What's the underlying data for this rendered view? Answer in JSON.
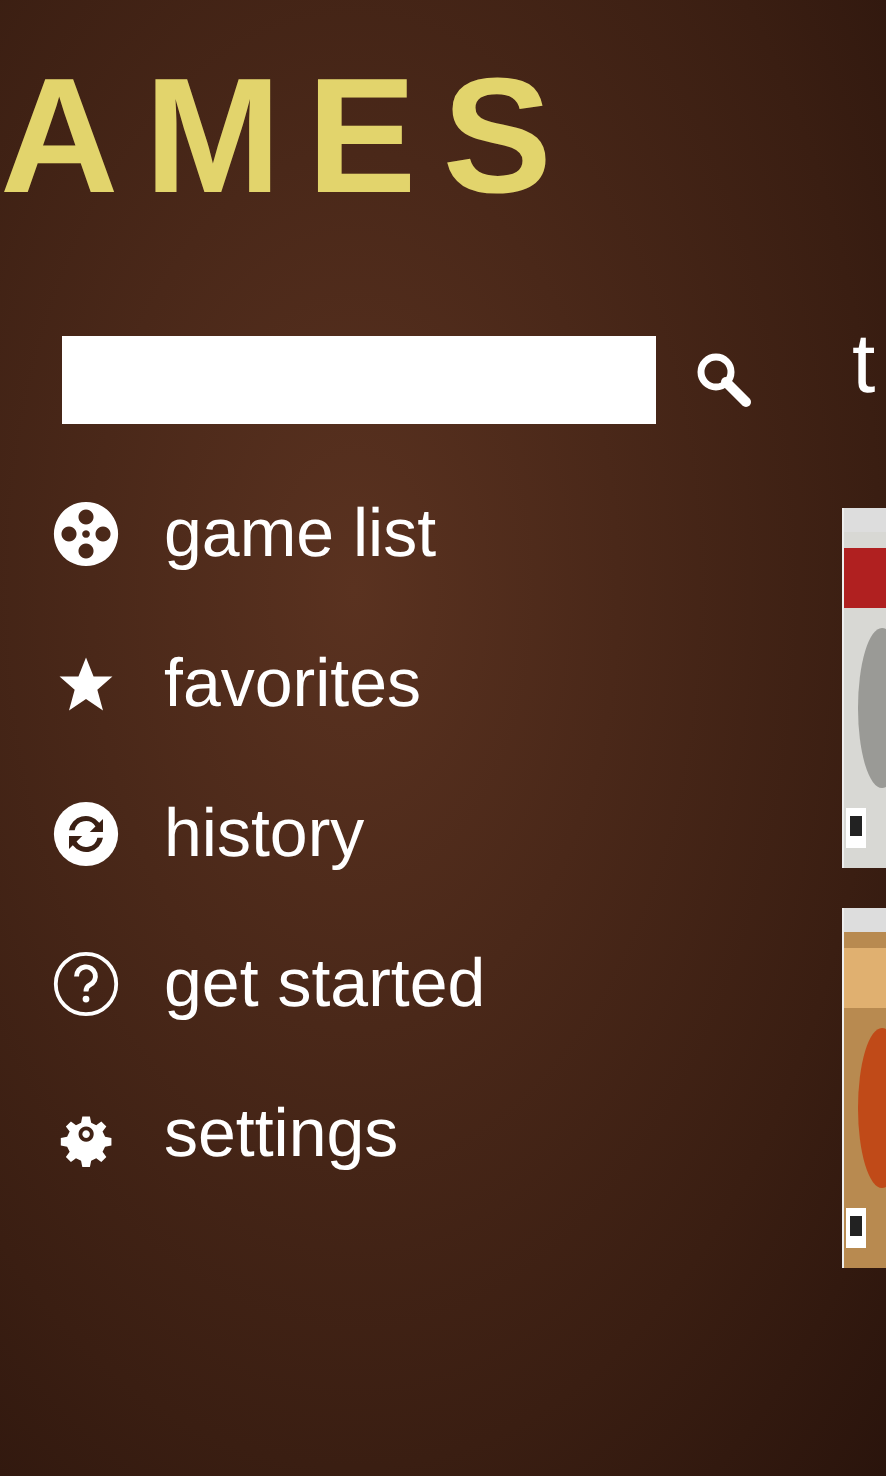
{
  "title": "AMES",
  "menu": [
    {
      "kind": "reel",
      "label": "game list"
    },
    {
      "kind": "star",
      "label": "favorites"
    },
    {
      "kind": "refresh",
      "label": "history"
    },
    {
      "kind": "help",
      "label": "get started"
    },
    {
      "kind": "gear",
      "label": "settings"
    }
  ],
  "next_panel": {
    "heading": "t"
  }
}
